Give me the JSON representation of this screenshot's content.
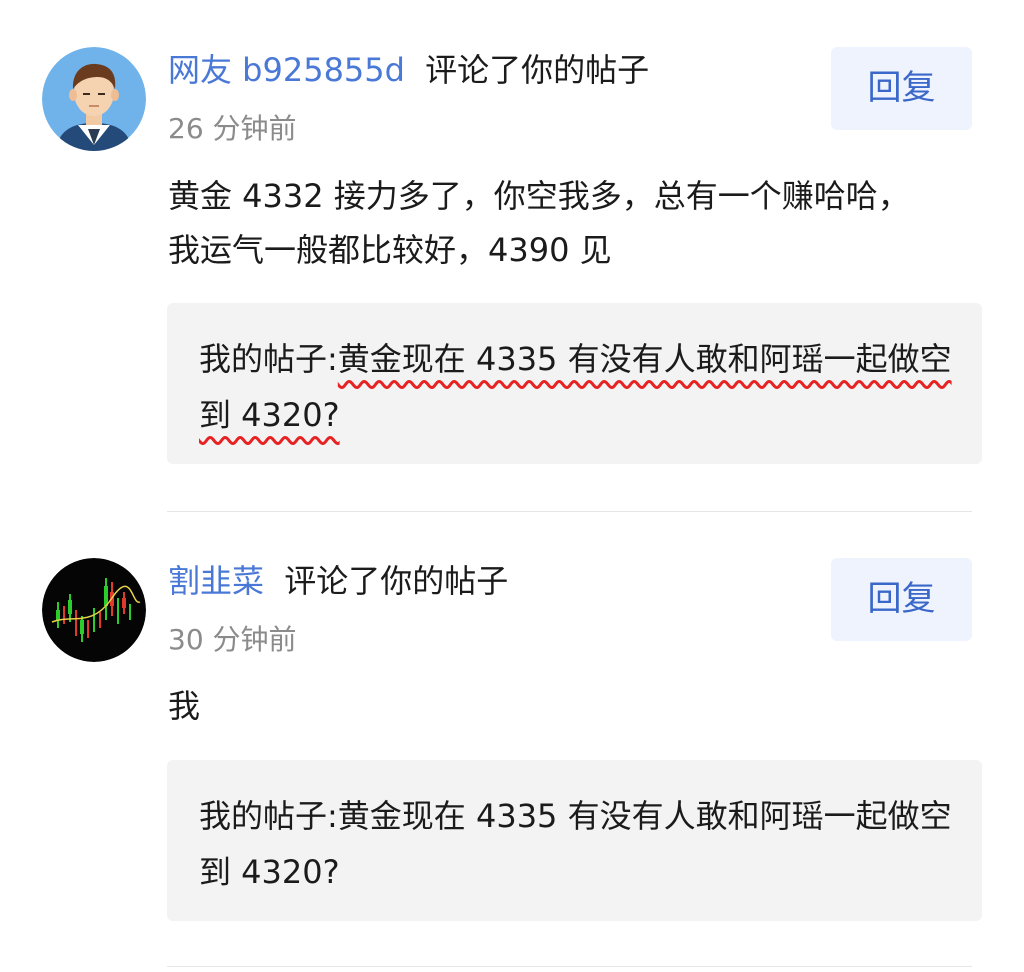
{
  "comments": [
    {
      "username": "网友 b925855d",
      "action": "评论了你的帖子",
      "time": "26 分钟前",
      "reply_label": "回复",
      "text": "黄金 4332 接力多了，你空我多，总有一个赚哈哈，我运气一般都比较好，4390 见",
      "quote_prefix": "我的帖子:",
      "quote_body": "黄金现在 4335 有没有人敢和阿瑶一起做空到 4320?",
      "avatar_icon": "man-avatar-icon"
    },
    {
      "username": "割韭菜",
      "action": "评论了你的帖子",
      "time": "30 分钟前",
      "reply_label": "回复",
      "text": "我",
      "quote_prefix": "我的帖子:",
      "quote_body": "黄金现在 4335 有没有人敢和阿瑶一起做空到 4320?",
      "avatar_icon": "stock-chart-avatar-icon"
    }
  ],
  "colors": {
    "username": "#4a78d6",
    "reply_text": "#3a67c9",
    "reply_bg": "#eef3fd",
    "quote_bg": "#f3f3f3",
    "squiggle": "#e62222",
    "time": "#8b8b8b"
  }
}
